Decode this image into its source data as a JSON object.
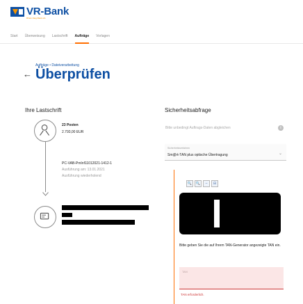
{
  "brand": {
    "name": "VR-Bank",
    "sub": "Rhein-Sieg-Bank eG"
  },
  "nav": [
    "Start",
    "Überweisung",
    "Lastschrift",
    "Aufträge",
    "Vorlagen"
  ],
  "nav_active": 3,
  "breadcrumb": "Aufträge • Dateiverarbeitung",
  "page_title": "Überprüfen",
  "left": {
    "title": "Ihre Lastschrift",
    "count": "23 Posten",
    "amount": "2.793,00 EUR",
    "file": "PC-VAB-PmInf11012021-1412-1",
    "execution_date": "Ausführung am: 13.01.2021",
    "repeat": "Ausführung wiederholend"
  },
  "right": {
    "title": "Sicherheitsabfrage",
    "subtitle": "Bitte unbedingt Auftrags-Daten abgleichen",
    "procedure_label": "Sicherheitsverfahren",
    "procedure_value": "Sm@rt-TAN plus optische Übertragung",
    "toolbar": [
      "🔍",
      "🔍",
      "–",
      "⊟"
    ],
    "instruction": "Bitte geben Sie die auf Ihrem TAN-Generator angezeigte TAN ein.",
    "tan_placeholder": "TAN",
    "tan_error": "TAN erforderlich."
  },
  "colors": {
    "brand_blue": "#0d4fa3",
    "accent_orange": "#ff6e00",
    "error_red": "#cc3333"
  }
}
